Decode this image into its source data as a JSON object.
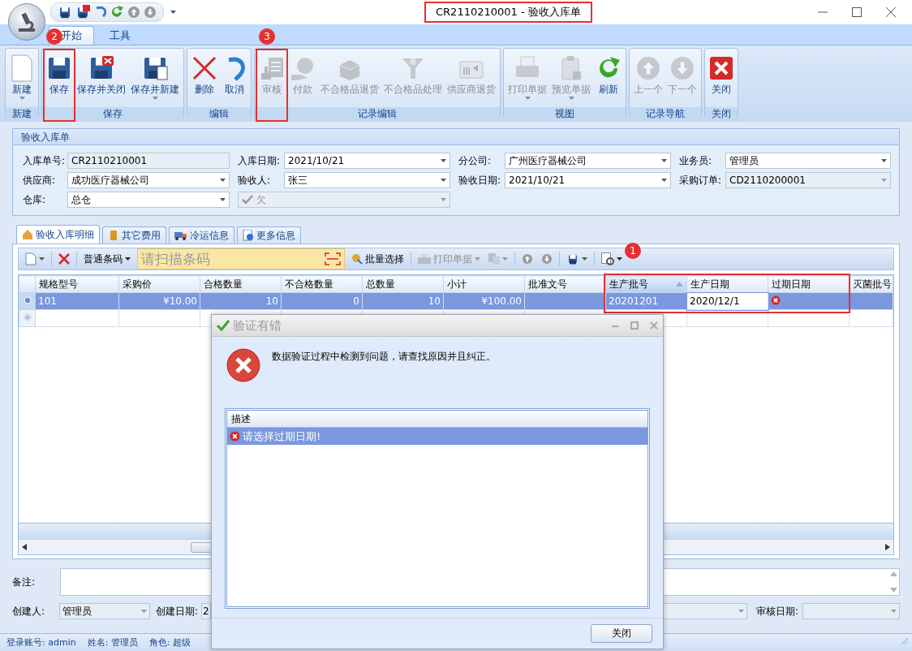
{
  "window": {
    "title": "CR2110210001 - 验收入库单",
    "highlighted": true
  },
  "ribbon_tabs": [
    {
      "label": "开始",
      "selected": true
    },
    {
      "label": "工具",
      "selected": false
    }
  ],
  "ribbon_groups": [
    {
      "label": "新建",
      "buttons": [
        {
          "label": "新建",
          "disabled": false,
          "dropdown": true,
          "highlighted": false
        }
      ]
    },
    {
      "label": "保存",
      "buttons": [
        {
          "label": "保存",
          "disabled": false,
          "dropdown": false,
          "highlighted": true,
          "badge": "2"
        },
        {
          "label": "保存并关闭",
          "disabled": false,
          "dropdown": false,
          "highlighted": false
        },
        {
          "label": "保存并新建",
          "disabled": false,
          "dropdown": true,
          "highlighted": false
        }
      ]
    },
    {
      "label": "编辑",
      "buttons": [
        {
          "label": "删除",
          "disabled": false,
          "dropdown": false,
          "highlighted": false
        },
        {
          "label": "取消",
          "disabled": false,
          "dropdown": false,
          "highlighted": false
        }
      ]
    },
    {
      "label": "记录编辑",
      "buttons": [
        {
          "label": "审核",
          "disabled": true,
          "dropdown": false,
          "highlighted": true,
          "badge": "3"
        },
        {
          "label": "付款",
          "disabled": true,
          "dropdown": false,
          "highlighted": false
        },
        {
          "label": "不合格品退货",
          "disabled": true,
          "dropdown": false,
          "highlighted": false
        },
        {
          "label": "不合格品处理",
          "disabled": true,
          "dropdown": false,
          "highlighted": false
        },
        {
          "label": "供应商退货",
          "disabled": true,
          "dropdown": false,
          "highlighted": false
        }
      ]
    },
    {
      "label": "视图",
      "buttons": [
        {
          "label": "打印单据",
          "disabled": true,
          "dropdown": true,
          "highlighted": false
        },
        {
          "label": "预览单据",
          "disabled": true,
          "dropdown": true,
          "highlighted": false
        },
        {
          "label": "刷新",
          "disabled": false,
          "dropdown": false,
          "highlighted": false
        }
      ]
    },
    {
      "label": "记录导航",
      "buttons": [
        {
          "label": "上一个",
          "disabled": true,
          "dropdown": false,
          "highlighted": false
        },
        {
          "label": "下一个",
          "disabled": true,
          "dropdown": false,
          "highlighted": false
        }
      ]
    },
    {
      "label": "关闭",
      "buttons": [
        {
          "label": "关闭",
          "disabled": false,
          "dropdown": false,
          "highlighted": false
        }
      ]
    }
  ],
  "form": {
    "title": "验收入库单",
    "fields": [
      {
        "label": "入库单号:",
        "value": "CR2110210001",
        "kind": "text",
        "disabled": true
      },
      {
        "label": "入库日期:",
        "value": "2021/10/21",
        "kind": "dropdown",
        "disabled": false
      },
      {
        "label": "分公司:",
        "value": "广州医疗器械公司",
        "kind": "dropdown",
        "disabled": false
      },
      {
        "label": "业务员:",
        "value": "管理员",
        "kind": "dropdown",
        "disabled": false
      },
      {
        "label": "供应商:",
        "value": "成功医疗器械公司",
        "kind": "dropdown",
        "disabled": false
      },
      {
        "label": "验收人:",
        "value": "张三",
        "kind": "dropdown",
        "disabled": false
      },
      {
        "label": "验收日期:",
        "value": "2021/10/21",
        "kind": "dropdown",
        "disabled": false
      },
      {
        "label": "采购订单:",
        "value": "CD2110200001",
        "kind": "dropdown",
        "disabled": true
      },
      {
        "label": "仓库:",
        "value": "总仓",
        "kind": "dropdown",
        "disabled": false
      },
      {
        "value": "欠",
        "kind": "check-dropdown",
        "disabled": true,
        "checked": true
      }
    ]
  },
  "detail_tabs": [
    {
      "label": "验收入库明细",
      "selected": true
    },
    {
      "label": "其它费用",
      "selected": false
    },
    {
      "label": "冷运信息",
      "selected": false
    },
    {
      "label": "更多信息",
      "selected": false
    }
  ],
  "grid_toolbar": {
    "barcode_type": "普通条码",
    "scan_placeholder": "请扫描条码",
    "batch_select": "批量选择",
    "print": {
      "label": "打印单据",
      "disabled": true
    },
    "badge": "1"
  },
  "table": {
    "columns": [
      {
        "label": "规格型号",
        "sorted": false
      },
      {
        "label": "采购价",
        "sorted": false
      },
      {
        "label": "合格数量",
        "sorted": false
      },
      {
        "label": "不合格数量",
        "sorted": false
      },
      {
        "label": "总数量",
        "sorted": false
      },
      {
        "label": "小计",
        "sorted": false
      },
      {
        "label": "批准文号",
        "sorted": false
      },
      {
        "label": "生产批号",
        "sorted": true
      },
      {
        "label": "生产日期",
        "sorted": false
      },
      {
        "label": "过期日期",
        "sorted": false
      },
      {
        "label": "灭菌批号",
        "sorted": false
      }
    ],
    "rows": [
      {
        "selected": true,
        "cells": [
          {
            "kind": "text",
            "text": "101"
          },
          {
            "kind": "text",
            "text": "¥10.00"
          },
          {
            "kind": "text",
            "text": "10"
          },
          {
            "kind": "text",
            "text": "0"
          },
          {
            "kind": "text",
            "text": "10"
          },
          {
            "kind": "text",
            "text": "¥100.00"
          },
          {
            "kind": "empty"
          },
          {
            "kind": "text",
            "text": "20201201"
          },
          {
            "kind": "editing",
            "text": "2020/12/1"
          },
          {
            "kind": "error"
          },
          {
            "kind": "empty"
          }
        ]
      }
    ],
    "highlighted": true
  },
  "notes": {
    "label": "备注:"
  },
  "footer_fields": [
    {
      "label": "创建人:",
      "value": "管理员"
    },
    {
      "label": "创建日期:",
      "value": "2"
    },
    {
      "label": "审核日期:"
    }
  ],
  "status_bar": [
    "登录账号: admin",
    "姓名: 管理员",
    "角色: 超级"
  ],
  "dialog": {
    "title": "验证有错",
    "message": "数据验证过程中检测到问题，请查找原因并且纠正。",
    "list_header": "描述",
    "errors": [
      {
        "text": "请选择过期日期!",
        "selected": true
      }
    ],
    "button": "关闭"
  }
}
